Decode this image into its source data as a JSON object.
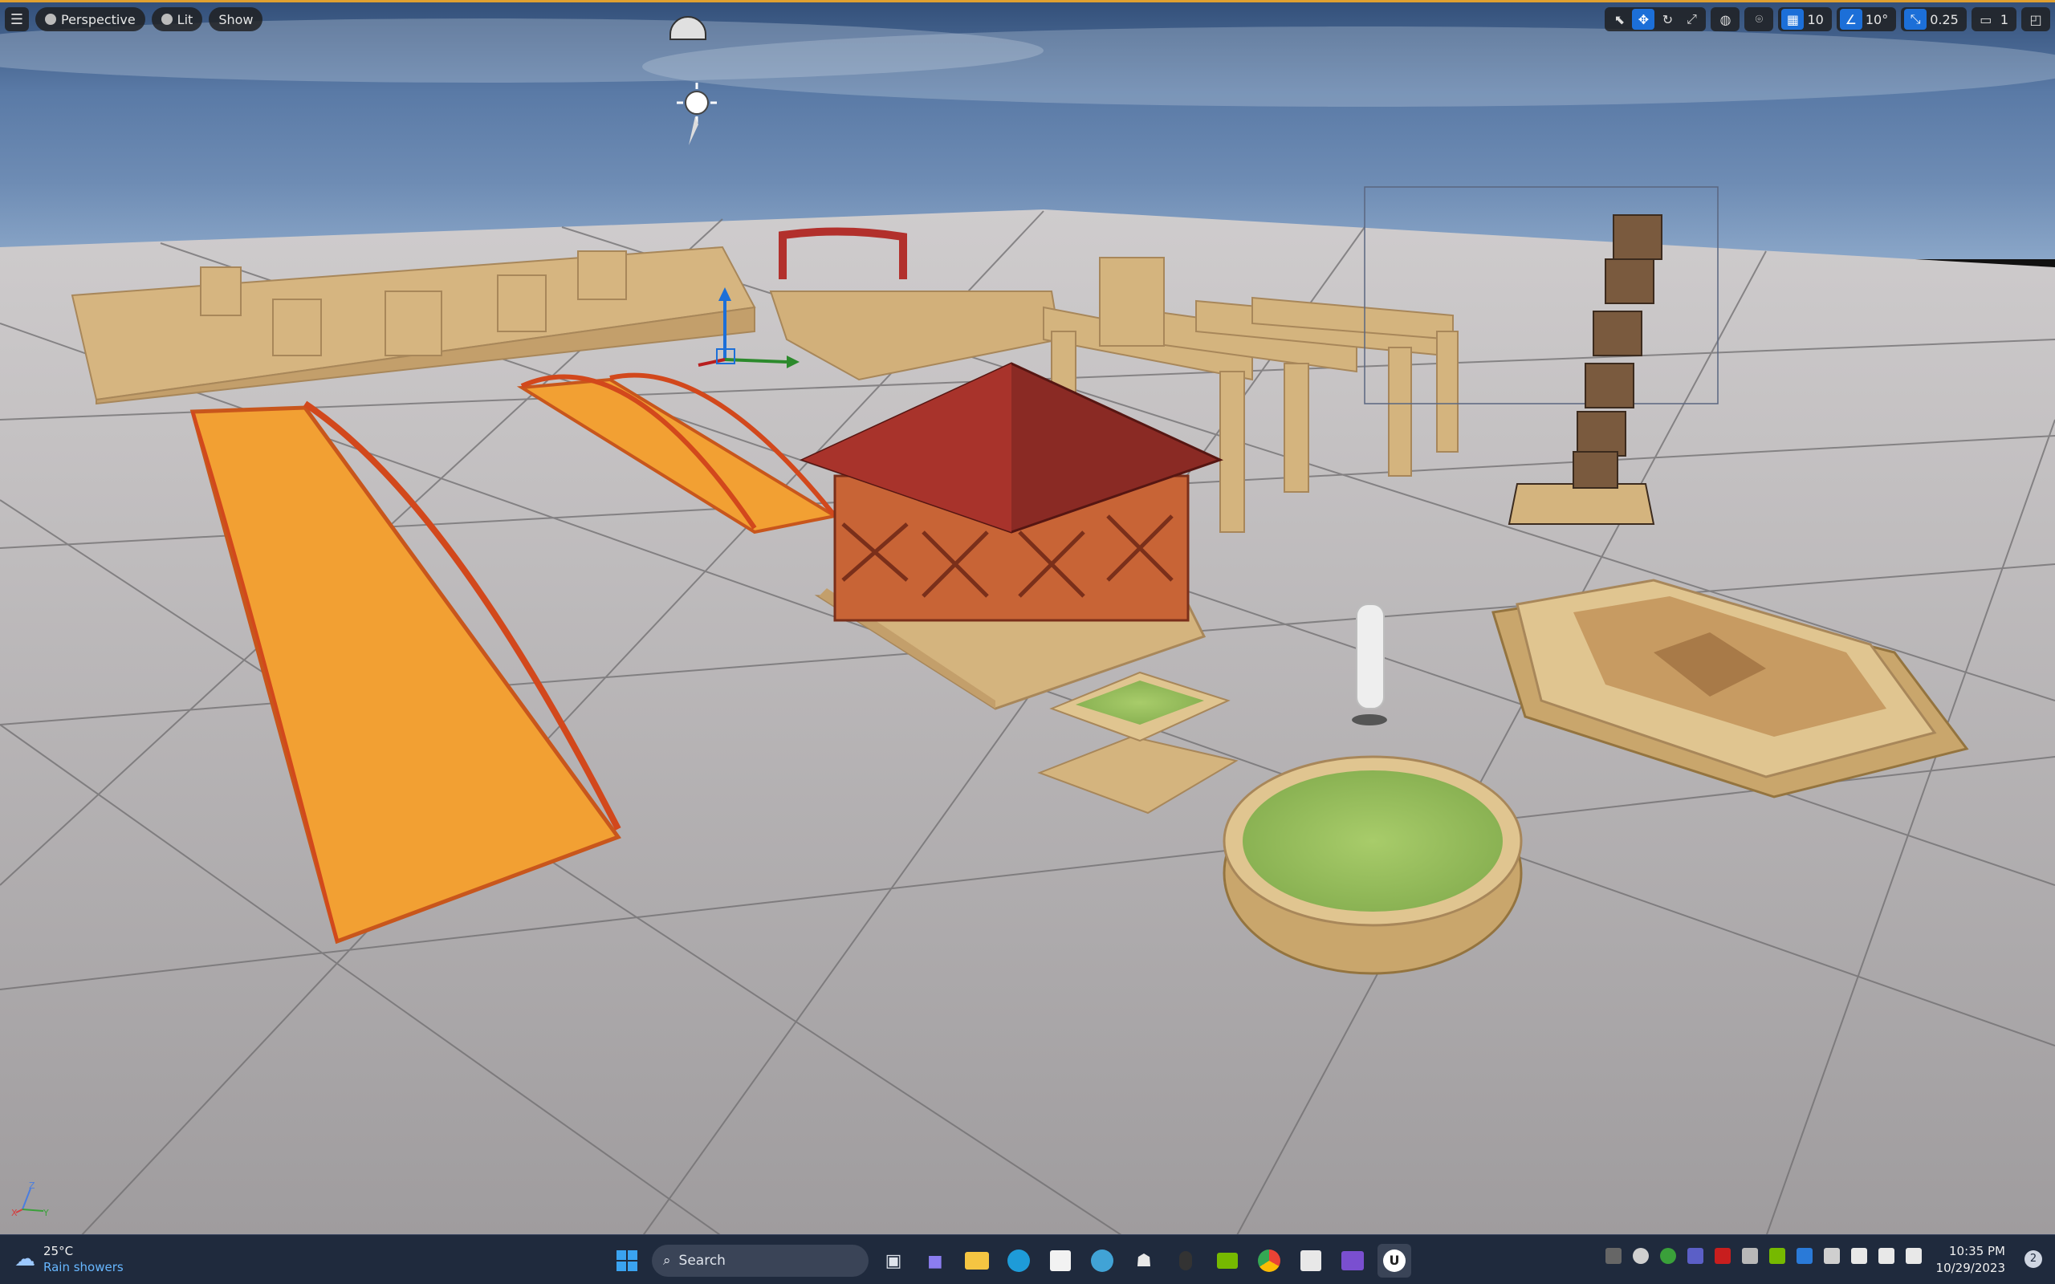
{
  "viewport": {
    "view_mode": "Perspective",
    "lighting_mode": "Lit",
    "show_label": "Show",
    "grid_snap_value": "10",
    "rotation_snap_value": "10°",
    "scale_snap_value": "0.25",
    "camera_speed": "1",
    "axis": {
      "z": "Z",
      "x": "X",
      "y": "Y"
    }
  },
  "taskbar": {
    "weather": {
      "temp": "25°C",
      "condition": "Rain showers"
    },
    "search_placeholder": "Search",
    "clock": {
      "time": "10:35 PM",
      "date": "10/29/2023"
    },
    "notifications": "2",
    "apps": [
      "start-icon",
      "search",
      "task-view-icon",
      "chat-icon",
      "file-explorer-icon",
      "edge-icon",
      "store-icon",
      "browser-icon",
      "alien-icon",
      "mouse-icon",
      "nvidia-icon",
      "chrome-icon",
      "app-icon",
      "clapper-icon",
      "unreal-engine-icon"
    ]
  },
  "colors": {
    "accent": "#1c6fd8",
    "viewport_border": "#e0a030",
    "taskbar_bg": "#1f2a3d"
  }
}
